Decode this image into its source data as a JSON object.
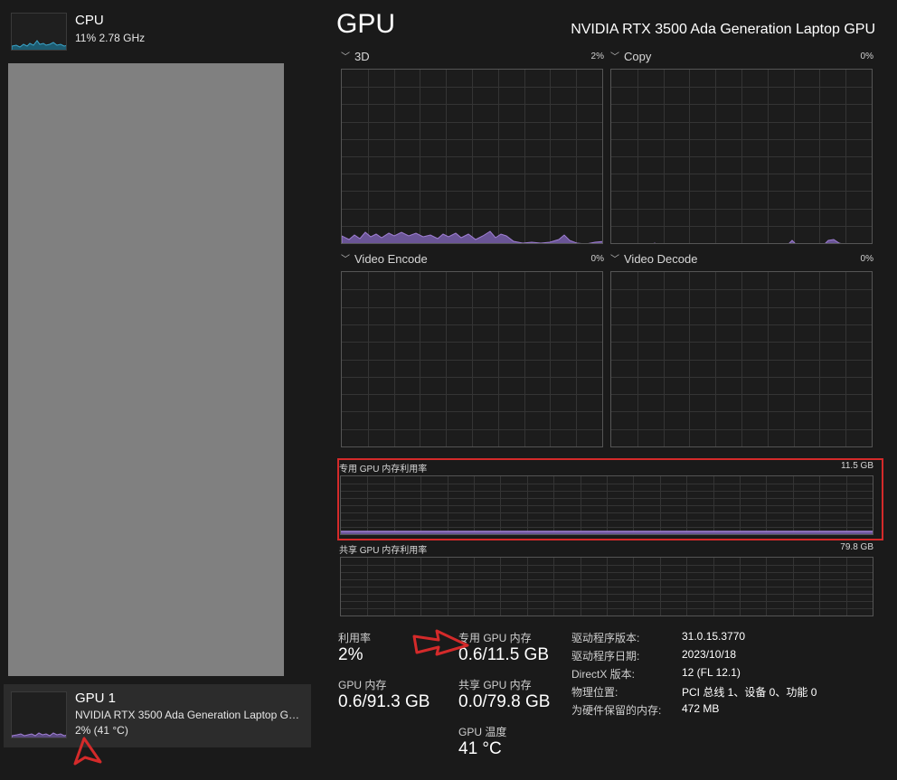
{
  "sidebar": {
    "cpu": {
      "title": "CPU",
      "subtitle": "11%  2.78 GHz"
    },
    "gpu1": {
      "title": "GPU 1",
      "subtitle": "NVIDIA RTX 3500 Ada Generation Laptop GPU",
      "detail": "2%  (41 °C)"
    }
  },
  "header": {
    "title": "GPU",
    "model": "NVIDIA RTX 3500 Ada Generation Laptop GPU"
  },
  "graphs": {
    "g3d": {
      "label": "3D",
      "pct": "2%"
    },
    "copy": {
      "label": "Copy",
      "pct": "0%"
    },
    "venc": {
      "label": "Video Encode",
      "pct": "0%"
    },
    "vdec": {
      "label": "Video Decode",
      "pct": "0%"
    },
    "dedicated": {
      "label": "专用 GPU 内存利用率",
      "max": "11.5 GB"
    },
    "shared": {
      "label": "共享 GPU 内存利用率",
      "max": "79.8 GB"
    }
  },
  "stats": {
    "util_label": "利用率",
    "util_value": "2%",
    "ded_label": "专用 GPU 内存",
    "ded_value": "0.6/11.5 GB",
    "gpumem_label": "GPU 内存",
    "gpumem_value": "0.6/91.3 GB",
    "shared_label": "共享 GPU 内存",
    "shared_value": "0.0/79.8 GB",
    "temp_label": "GPU 温度",
    "temp_value": "41 °C"
  },
  "info": [
    {
      "key": "驱动程序版本:",
      "value": "31.0.15.3770"
    },
    {
      "key": "驱动程序日期:",
      "value": "2023/10/18"
    },
    {
      "key": "DirectX 版本:",
      "value": "12 (FL 12.1)"
    },
    {
      "key": "物理位置:",
      "value": "PCI 总线 1、设备 0、功能 0"
    },
    {
      "key": "为硬件保留的内存:",
      "value": "472 MB"
    }
  ],
  "colors": {
    "gpu_graph": "#a07fd4",
    "cpu_graph": "#3aa4c8",
    "annotation": "#d42a2a"
  },
  "icons": {
    "collapse": "chevron-down-icon",
    "pointer": "arrow-pointer-icon"
  }
}
